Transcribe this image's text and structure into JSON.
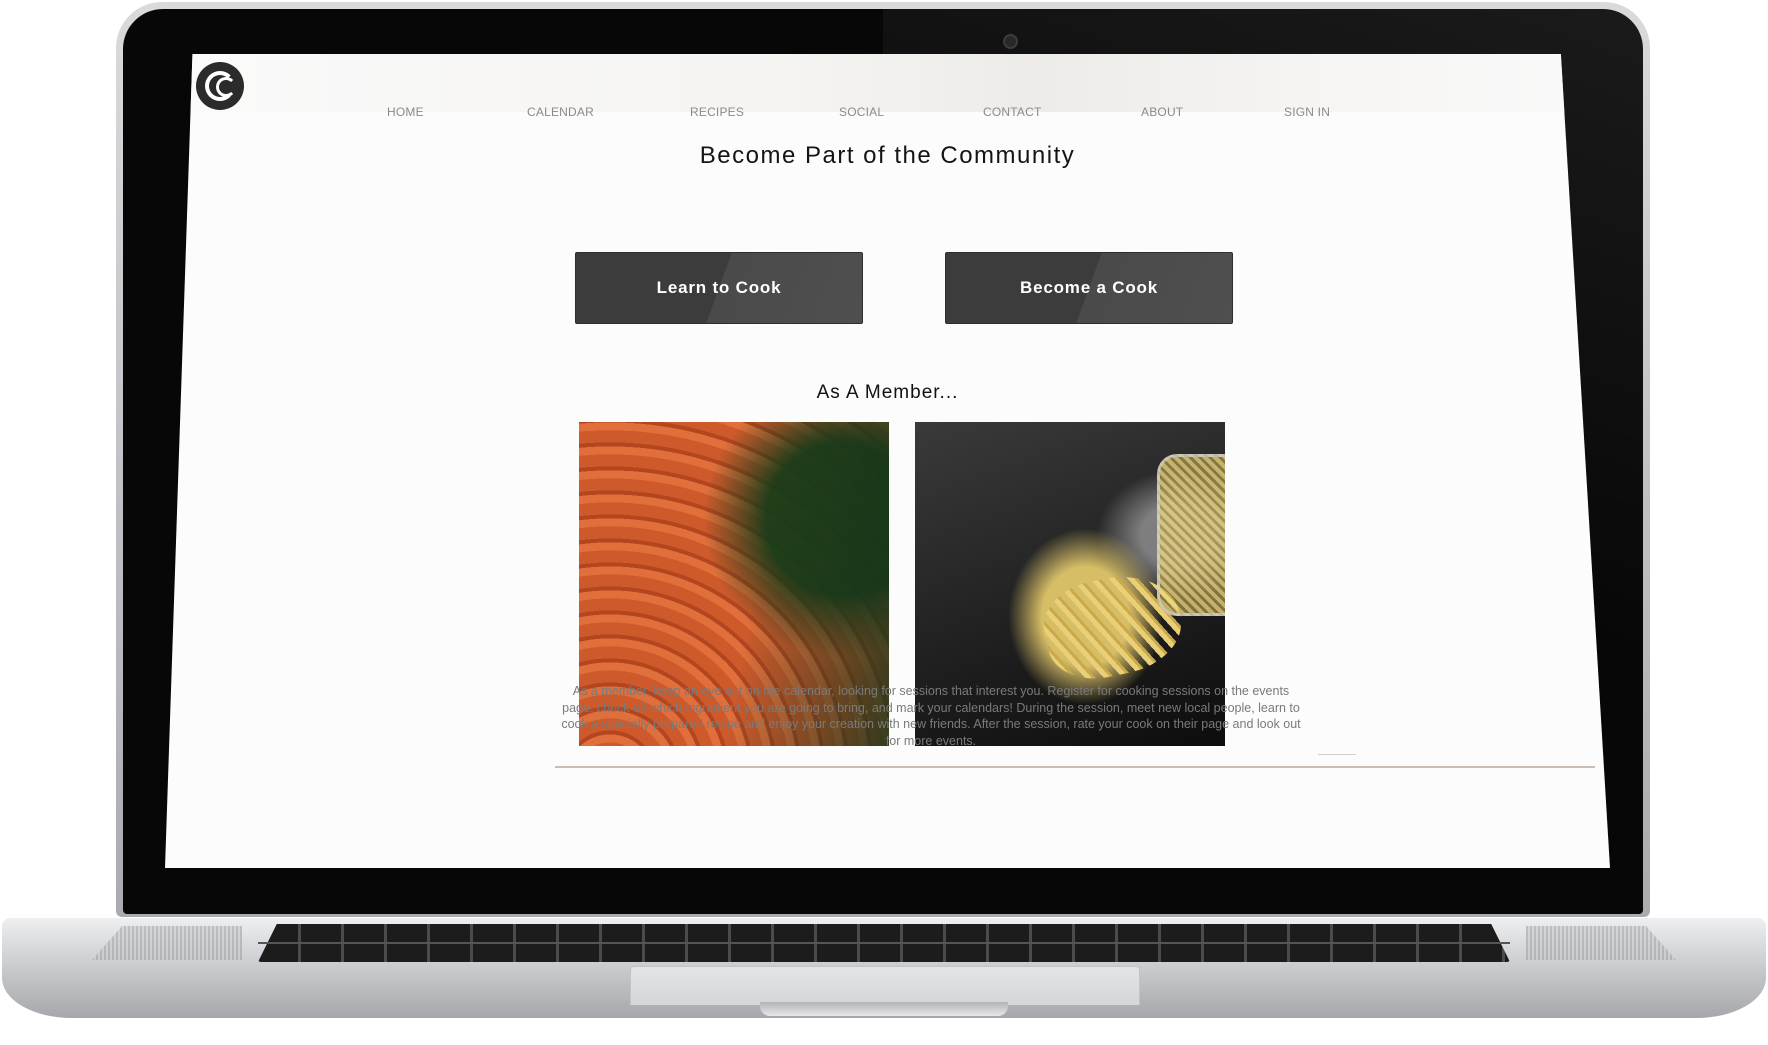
{
  "nav": {
    "items": [
      {
        "label": "HOME"
      },
      {
        "label": "CALENDAR"
      },
      {
        "label": "RECIPES"
      },
      {
        "label": "SOCIAL"
      },
      {
        "label": "CONTACT"
      },
      {
        "label": "ABOUT"
      },
      {
        "label": "SIGN IN"
      }
    ]
  },
  "hero": {
    "title": "Become Part of the Community"
  },
  "actions": {
    "learn_label": "Learn to Cook",
    "become_label": "Become a Cook"
  },
  "member": {
    "heading": "As A Member...",
    "images": [
      {
        "subject": "carrots"
      },
      {
        "subject": "pasta spilling from jar"
      }
    ],
    "description": "As a member, keep an eye out on the calendar, looking for sessions that interest you. Register for cooking sessions on the events page, check off which ingredient you are going to bring, and mark your calendars! During the session, meet new local people, learn to cook a specially prepared recipe and enjoy your creation with new friends. After the session, rate your cook on their page and look out for more events."
  },
  "colors": {
    "button_bg": "#3c3c3c",
    "nav_text": "#8a8a8a",
    "title_text": "#141414"
  },
  "icons": {
    "logo": "chef-hat-logo-icon"
  }
}
